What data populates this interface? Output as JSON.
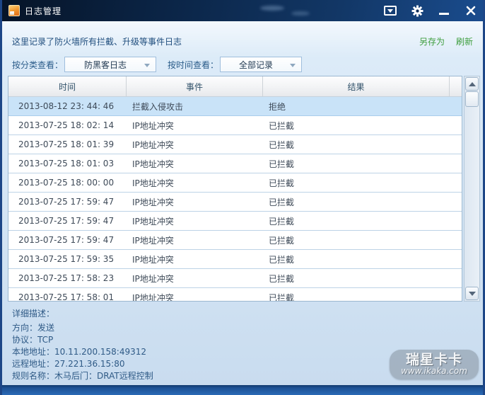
{
  "window": {
    "title": "日志管理"
  },
  "toolbar": {
    "description": "这里记录了防火墙所有拦截、升级等事件日志",
    "save_as_label": "另存为",
    "refresh_label": "刷新"
  },
  "filters": {
    "category_label": "按分类查看：",
    "category_value": "防黑客日志",
    "time_label": "按时间查看：",
    "time_value": "全部记录"
  },
  "table": {
    "columns": [
      "时间",
      "事件",
      "结果"
    ],
    "selected_index": 0,
    "rows": [
      {
        "time": "2013-08-12 23: 44: 46",
        "event": "拦截入侵攻击",
        "result": "拒绝"
      },
      {
        "time": "2013-07-25 18: 02: 14",
        "event": "IP地址冲突",
        "result": "已拦截"
      },
      {
        "time": "2013-07-25 18: 01: 39",
        "event": "IP地址冲突",
        "result": "已拦截"
      },
      {
        "time": "2013-07-25 18: 01: 03",
        "event": "IP地址冲突",
        "result": "已拦截"
      },
      {
        "time": "2013-07-25 18: 00: 00",
        "event": "IP地址冲突",
        "result": "已拦截"
      },
      {
        "time": "2013-07-25 17: 59: 47",
        "event": "IP地址冲突",
        "result": "已拦截"
      },
      {
        "time": "2013-07-25 17: 59: 47",
        "event": "IP地址冲突",
        "result": "已拦截"
      },
      {
        "time": "2013-07-25 17: 59: 47",
        "event": "IP地址冲突",
        "result": "已拦截"
      },
      {
        "time": "2013-07-25 17: 59: 35",
        "event": "IP地址冲突",
        "result": "已拦截"
      },
      {
        "time": "2013-07-25 17: 58: 23",
        "event": "IP地址冲突",
        "result": "已拦截"
      },
      {
        "time": "2013-07-25 17: 58: 01",
        "event": "IP地址冲突",
        "result": "已拦截"
      }
    ]
  },
  "details": {
    "label": "详细描述：",
    "lines": [
      "方向：发送",
      "协议：TCP",
      "本地地址：10.11.200.158:49312",
      "远程地址：27.221.36.15:80",
      "规则名称：木马后门：DRAT远程控制"
    ]
  },
  "watermark": {
    "brand": "瑞星卡卡",
    "url": "www.ikaka.com"
  },
  "icons": {
    "titlebar_app": "log-book-icon",
    "titlebar_buttons": [
      "chevron-down-box-icon",
      "gear-icon",
      "minimize-icon",
      "close-icon"
    ]
  },
  "colors": {
    "accent_green": "#3f9e3f",
    "titlebar_blue": "#0b2547",
    "selected_row": "#c9e3f8",
    "window_border": "#1d4687"
  }
}
